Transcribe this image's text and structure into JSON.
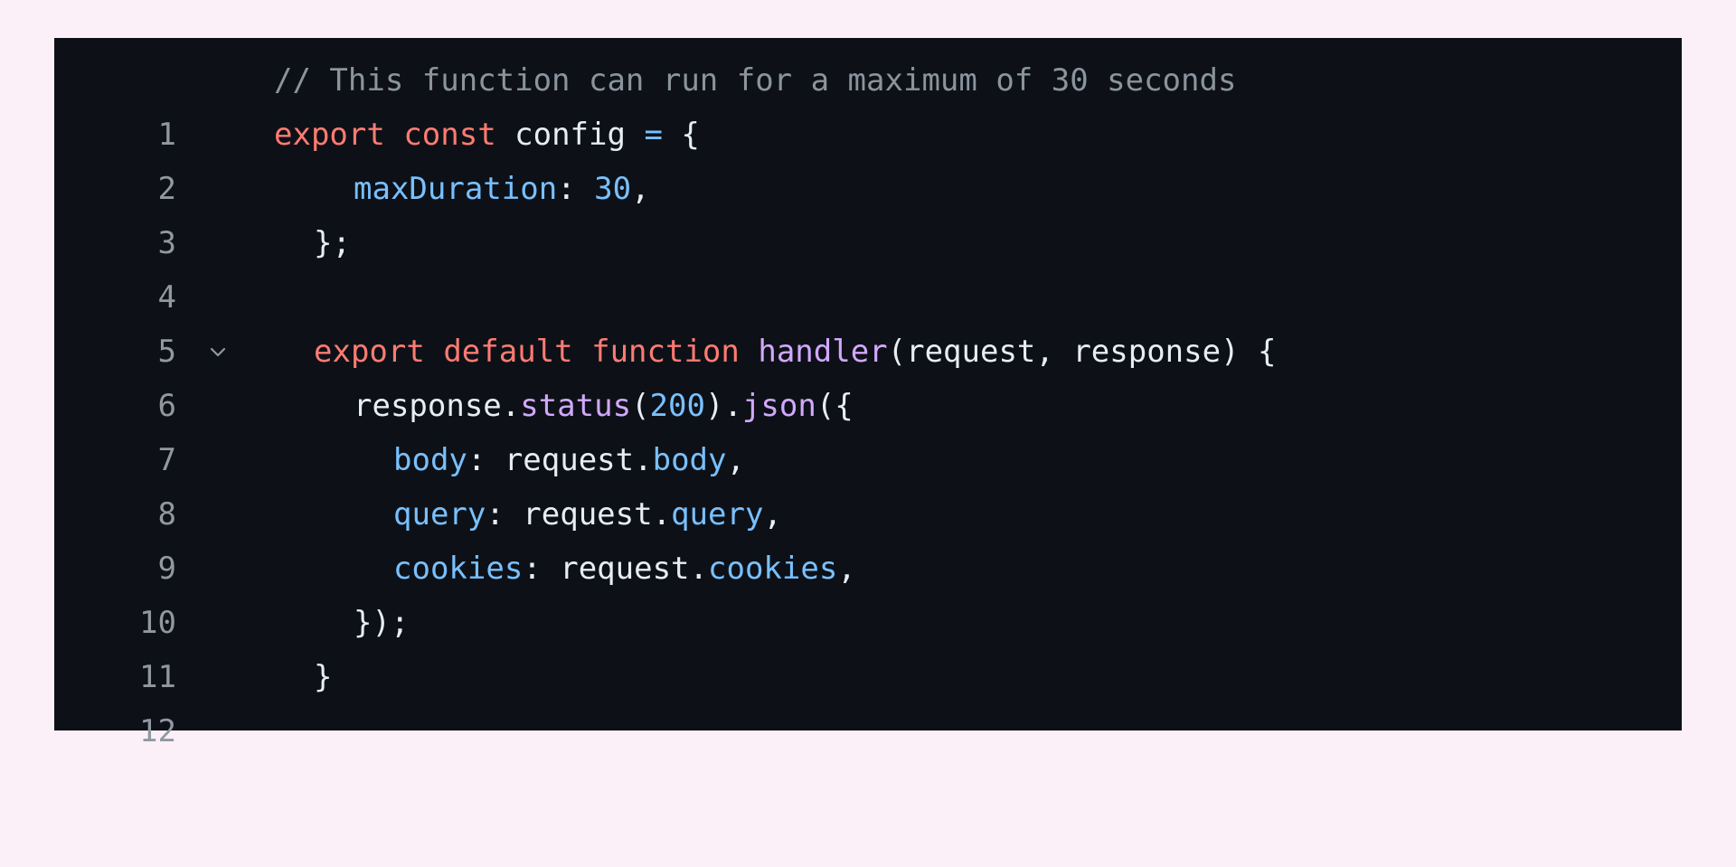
{
  "colors": {
    "page_background": "#fcf0f8",
    "editor_background": "#0d1117",
    "line_number": "#9198a1",
    "comment": "#8b949e",
    "keyword": "#ff7b72",
    "function": "#d2a8ff",
    "property": "#79c0ff",
    "text": "#e6edf3"
  },
  "fold_icon": "chevron-down-icon",
  "lines": [
    {
      "number": "1",
      "tokens": [
        "// This function can run for a maximum of 30 seconds"
      ]
    },
    {
      "number": "2",
      "tokens": [
        "export",
        " ",
        "const",
        " config ",
        "=",
        " {"
      ]
    },
    {
      "number": "3",
      "tokens": [
        "maxDuration",
        ": ",
        "30",
        ","
      ]
    },
    {
      "number": "4",
      "tokens": [
        "};"
      ]
    },
    {
      "number": "5",
      "tokens": []
    },
    {
      "number": "6",
      "tokens": [
        "export",
        " ",
        "default",
        " ",
        "function",
        " ",
        "handler",
        "(request, response) {"
      ]
    },
    {
      "number": "7",
      "tokens": [
        "response.",
        "status",
        "(",
        "200",
        ").",
        "json",
        "({"
      ]
    },
    {
      "number": "8",
      "tokens": [
        "body",
        ": request.",
        "body",
        ","
      ]
    },
    {
      "number": "9",
      "tokens": [
        "query",
        ": request.",
        "query",
        ","
      ]
    },
    {
      "number": "10",
      "tokens": [
        "cookies",
        ": request.",
        "cookies",
        ","
      ]
    },
    {
      "number": "11",
      "tokens": [
        "});"
      ]
    },
    {
      "number": "12",
      "tokens": [
        "}"
      ]
    }
  ]
}
